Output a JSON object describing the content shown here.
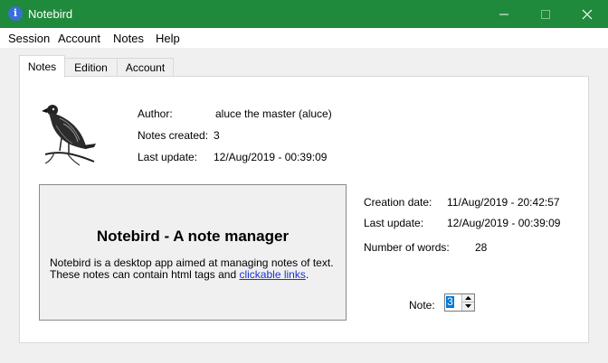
{
  "window": {
    "title": "Notebird",
    "icon": "info-icon"
  },
  "menu": [
    "Session",
    "Account",
    "Notes",
    "Help"
  ],
  "tabs": [
    "Notes",
    "Edition",
    "Account"
  ],
  "profile": {
    "author_label": "Author:",
    "author_value": "aluce the master (aluce)",
    "notes_created_label": "Notes created:",
    "notes_created_value": "3",
    "last_update_label": "Last update:",
    "last_update_value": "12/Aug/2019 - 00:39:09"
  },
  "note_details": {
    "creation_date_label": "Creation date:",
    "creation_date_value": "11/Aug/2019 - 20:42:57",
    "last_update_label": "Last update:",
    "last_update_value": "12/Aug/2019 - 00:39:09",
    "words_label": "Number of words:",
    "words_value": "28",
    "note_label": "Note:",
    "note_value": "3"
  },
  "description": {
    "title": "Notebird - A note manager",
    "line1": "Notebird is a desktop app aimed at managing notes of text.",
    "line2_prefix": "These notes can contain html tags and ",
    "link_text": "clickable links",
    "line2_suffix": "."
  },
  "colors": {
    "titlebar": "#1f8a3b",
    "link": "#1a33cc",
    "selection": "#0078d7"
  }
}
